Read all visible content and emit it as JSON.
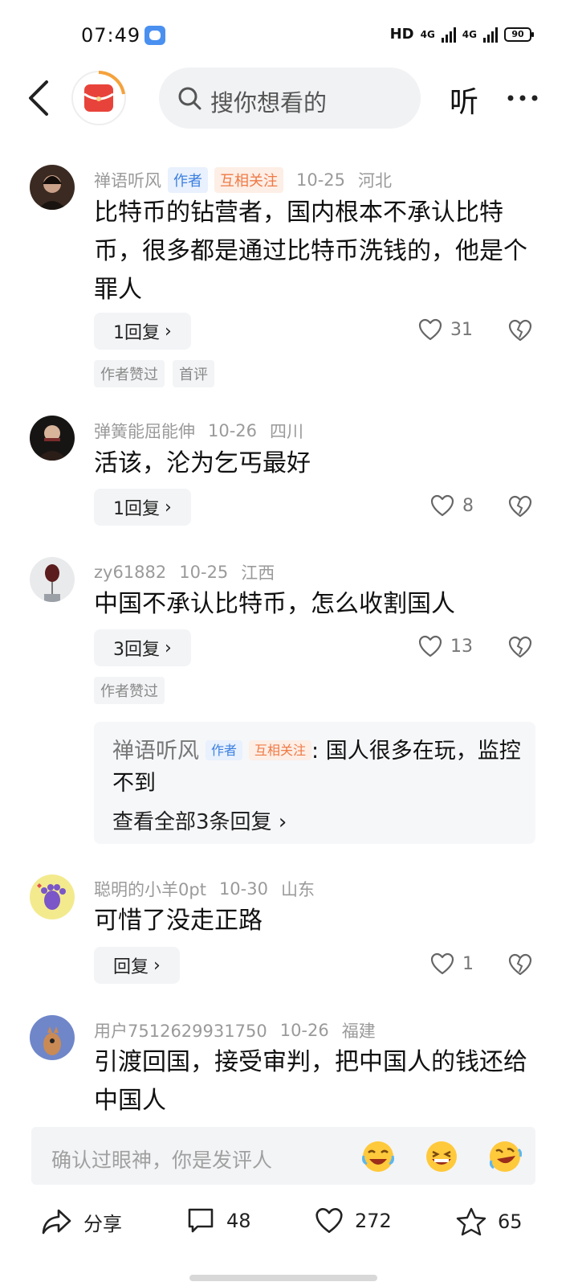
{
  "status_bar": {
    "time": "07:49",
    "hd": "HD",
    "net1": "4G",
    "net2": "4G",
    "battery": "90"
  },
  "nav": {
    "search_placeholder": "搜你想看的",
    "listen_label": "听"
  },
  "comments": [
    {
      "user": "禅语听风",
      "author_tag": "作者",
      "mutual_tag": "互相关注",
      "date": "10-25",
      "location": "河北",
      "text": "比特币的钻营者，国内根本不承认比特币，很多都是通过比特币洗钱的，他是个罪人",
      "replies": "1回复",
      "likes": "31",
      "badge1": "作者赞过",
      "badge2": "首评"
    },
    {
      "user": "弹簧能屈能伸",
      "date": "10-26",
      "location": "四川",
      "text": "活该，沦为乞丐最好",
      "replies": "1回复",
      "likes": "8"
    },
    {
      "user": "zy61882",
      "date": "10-25",
      "location": "江西",
      "text": "中国不承认比特币，怎么收割国人",
      "replies": "3回复",
      "likes": "13",
      "badge1": "作者赞过",
      "sub_reply": {
        "user": "禅语听风",
        "author_tag": "作者",
        "mutual_tag": "互相关注",
        "text": ": 国人很多在玩，监控不到",
        "view_all": "查看全部3条回复"
      }
    },
    {
      "user": "聪明的小羊0pt",
      "date": "10-30",
      "location": "山东",
      "text": "可惜了没走正路",
      "replies": "回复",
      "likes": "1"
    },
    {
      "user": "用户7512629931750",
      "date": "10-26",
      "location": "福建",
      "text": "引渡回国，接受审判，把中国人的钱还给中国人"
    }
  ],
  "comment_input": {
    "placeholder": "确认过眼神，你是发评人"
  },
  "action_bar": {
    "share_label": "分享",
    "comment_count": "48",
    "like_count": "272",
    "favorite_count": "65"
  },
  "icons": [
    "back-icon",
    "search-icon",
    "more-icon",
    "heart-icon",
    "broken-heart-icon",
    "share-icon",
    "comment-icon",
    "star-icon",
    "emoji-laugh-cry-icon",
    "emoji-grin-icon"
  ],
  "colors": {
    "accent_blue": "#3c7fe0",
    "mutual_orange": "#ee7a45",
    "logo_red": "#e8433a"
  }
}
